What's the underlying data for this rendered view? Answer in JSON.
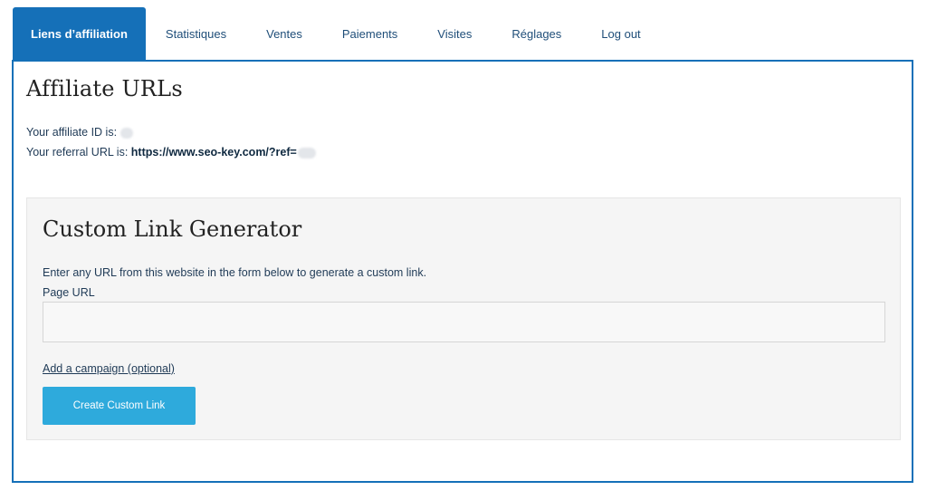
{
  "tabs": [
    {
      "label": "Liens d’affiliation",
      "active": true
    },
    {
      "label": "Statistiques"
    },
    {
      "label": "Ventes"
    },
    {
      "label": "Paiements"
    },
    {
      "label": "Visites"
    },
    {
      "label": "Réglages"
    },
    {
      "label": "Log out"
    }
  ],
  "affiliate": {
    "title": "Affiliate URLs",
    "id_label": "Your affiliate ID is:",
    "referral_label": "Your referral URL is:",
    "referral_url": "https://www.seo-key.com/?ref="
  },
  "generator": {
    "title": "Custom Link Generator",
    "description": "Enter any URL from this website in the form below to generate a custom link.",
    "page_url_label": "Page URL",
    "page_url_value": "",
    "campaign_link": "Add a campaign (optional)",
    "button_label": "Create Custom Link"
  },
  "colors": {
    "accent": "#1570b8",
    "button": "#2eaadc",
    "text": "#1f3a56",
    "box_background": "#f5f5f5"
  }
}
